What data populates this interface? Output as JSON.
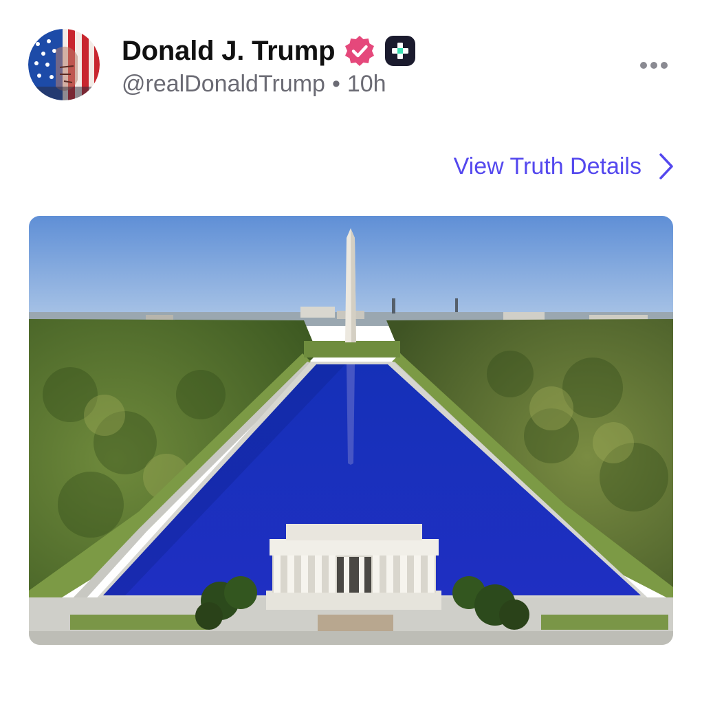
{
  "post": {
    "author": {
      "display_name": "Donald J. Trump",
      "handle": "@realDonaldTrump",
      "verified_icon": "verified-badge-icon",
      "badge_icon": "plus-badge-icon"
    },
    "separator": "•",
    "time": "10h",
    "more_icon": "more-horizontal-icon",
    "details_link": {
      "label": "View Truth Details",
      "icon": "chevron-right-icon"
    },
    "media": {
      "type": "photo",
      "icon": "photo"
    }
  },
  "colors": {
    "accent": "#5448ee",
    "verified_badge": "#e5487b",
    "plus_badge": "#1b1b2e",
    "plus_badge_cross": "#3ce0b4",
    "display_name": "#111111",
    "secondary_text": "#6b6b74",
    "more_dots": "#8a8a92"
  }
}
